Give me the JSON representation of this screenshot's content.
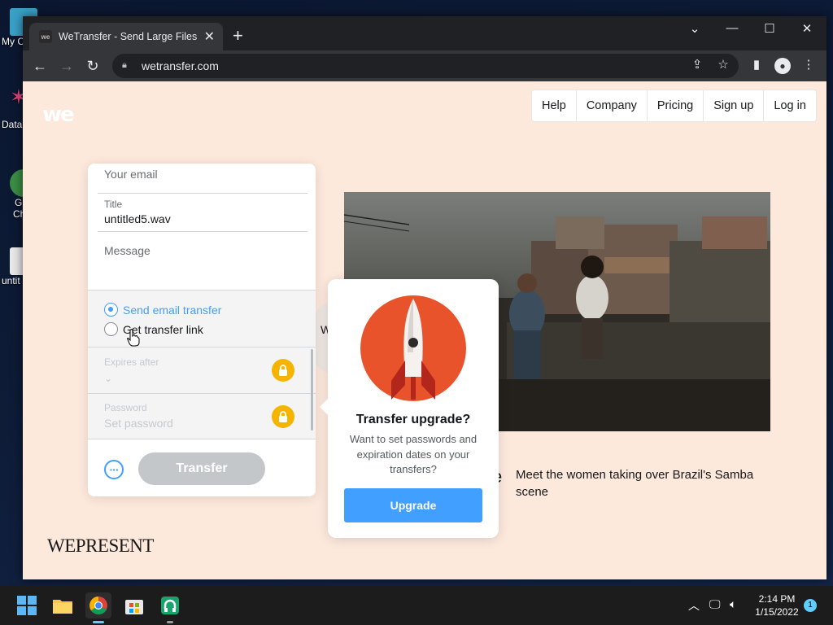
{
  "desktop": {
    "icons": [
      {
        "label": "My C",
        "icon": "this-pc-icon"
      },
      {
        "label": "Data",
        "icon": "shortcut-icon"
      },
      {
        "label": "G",
        "icon": "chrome-shortcut-icon"
      },
      {
        "label": "Ch",
        "icon": "chrome-shortcut-icon"
      },
      {
        "label": "untit",
        "icon": "file-icon"
      }
    ]
  },
  "browser": {
    "tab_title": "WeTransfer - Send Large Files & S",
    "favicon_text": "we",
    "url": "wetransfer.com"
  },
  "page": {
    "logo": "we",
    "nav": [
      "Help",
      "Company",
      "Pricing",
      "Sign up",
      "Log in"
    ],
    "panel": {
      "email_placeholder": "Your email",
      "title_label": "Title",
      "title_value": "untitled5.wav",
      "message_placeholder": "Message",
      "option_email": "Send email transfer",
      "option_link": "Get transfer link",
      "expires_label": "Expires after",
      "password_label": "Password",
      "password_placeholder": "Set password",
      "transfer_button": "Transfer",
      "more_button": "···"
    },
    "behind_letter_w": "W",
    "behind_letter_e": "e",
    "popover": {
      "title": "Transfer upgrade?",
      "description": "Want to set passwords and expiration dates on your transfers?",
      "button": "Upgrade"
    },
    "caption": "Meet the women taking over Brazil's Samba scene",
    "wepresent": "WEPRESENT"
  },
  "taskbar": {
    "time": "2:14 PM",
    "date": "1/15/2022",
    "notifications": "1"
  },
  "colors": {
    "page_bg": "#fde8dc",
    "accent_blue": "#409fff",
    "lock_yellow": "#f5b400",
    "rocket_orange": "#e8532b"
  }
}
